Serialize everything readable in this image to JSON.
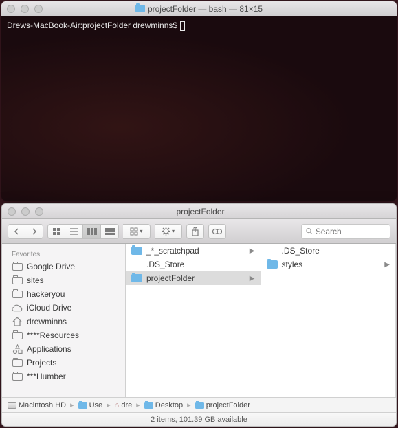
{
  "terminal": {
    "title": "projectFolder — bash — 81×15",
    "prompt": "Drews-MacBook-Air:projectFolder drewminns$"
  },
  "finder": {
    "title": "projectFolder",
    "search_placeholder": "Search",
    "sidebar": {
      "header": "Favorites",
      "items": [
        {
          "label": "Google Drive",
          "icon": "folder"
        },
        {
          "label": "sites",
          "icon": "folder"
        },
        {
          "label": "hackeryou",
          "icon": "folder"
        },
        {
          "label": "iCloud Drive",
          "icon": "cloud"
        },
        {
          "label": "drewminns",
          "icon": "home"
        },
        {
          "label": "****Resources",
          "icon": "folder"
        },
        {
          "label": "Applications",
          "icon": "apps"
        },
        {
          "label": "Projects",
          "icon": "folder"
        },
        {
          "label": "***Humber",
          "icon": "folder"
        }
      ]
    },
    "columns": [
      {
        "items": [
          {
            "label": "_*_scratchpad",
            "icon": "folder",
            "arrow": true,
            "selected": false
          },
          {
            "label": ".DS_Store",
            "icon": "none",
            "arrow": false,
            "selected": false
          },
          {
            "label": "projectFolder",
            "icon": "folder",
            "arrow": true,
            "selected": true
          }
        ]
      },
      {
        "items": [
          {
            "label": ".DS_Store",
            "icon": "none",
            "arrow": false,
            "selected": false
          },
          {
            "label": "styles",
            "icon": "folder",
            "arrow": true,
            "selected": false
          }
        ]
      }
    ],
    "pathbar": [
      {
        "label": "Macintosh HD",
        "icon": "hdd"
      },
      {
        "label": "Use",
        "icon": "folder"
      },
      {
        "label": "dre",
        "icon": "home"
      },
      {
        "label": "Desktop",
        "icon": "folder"
      },
      {
        "label": "projectFolder",
        "icon": "folder"
      }
    ],
    "status": "2 items, 101.39 GB available"
  }
}
